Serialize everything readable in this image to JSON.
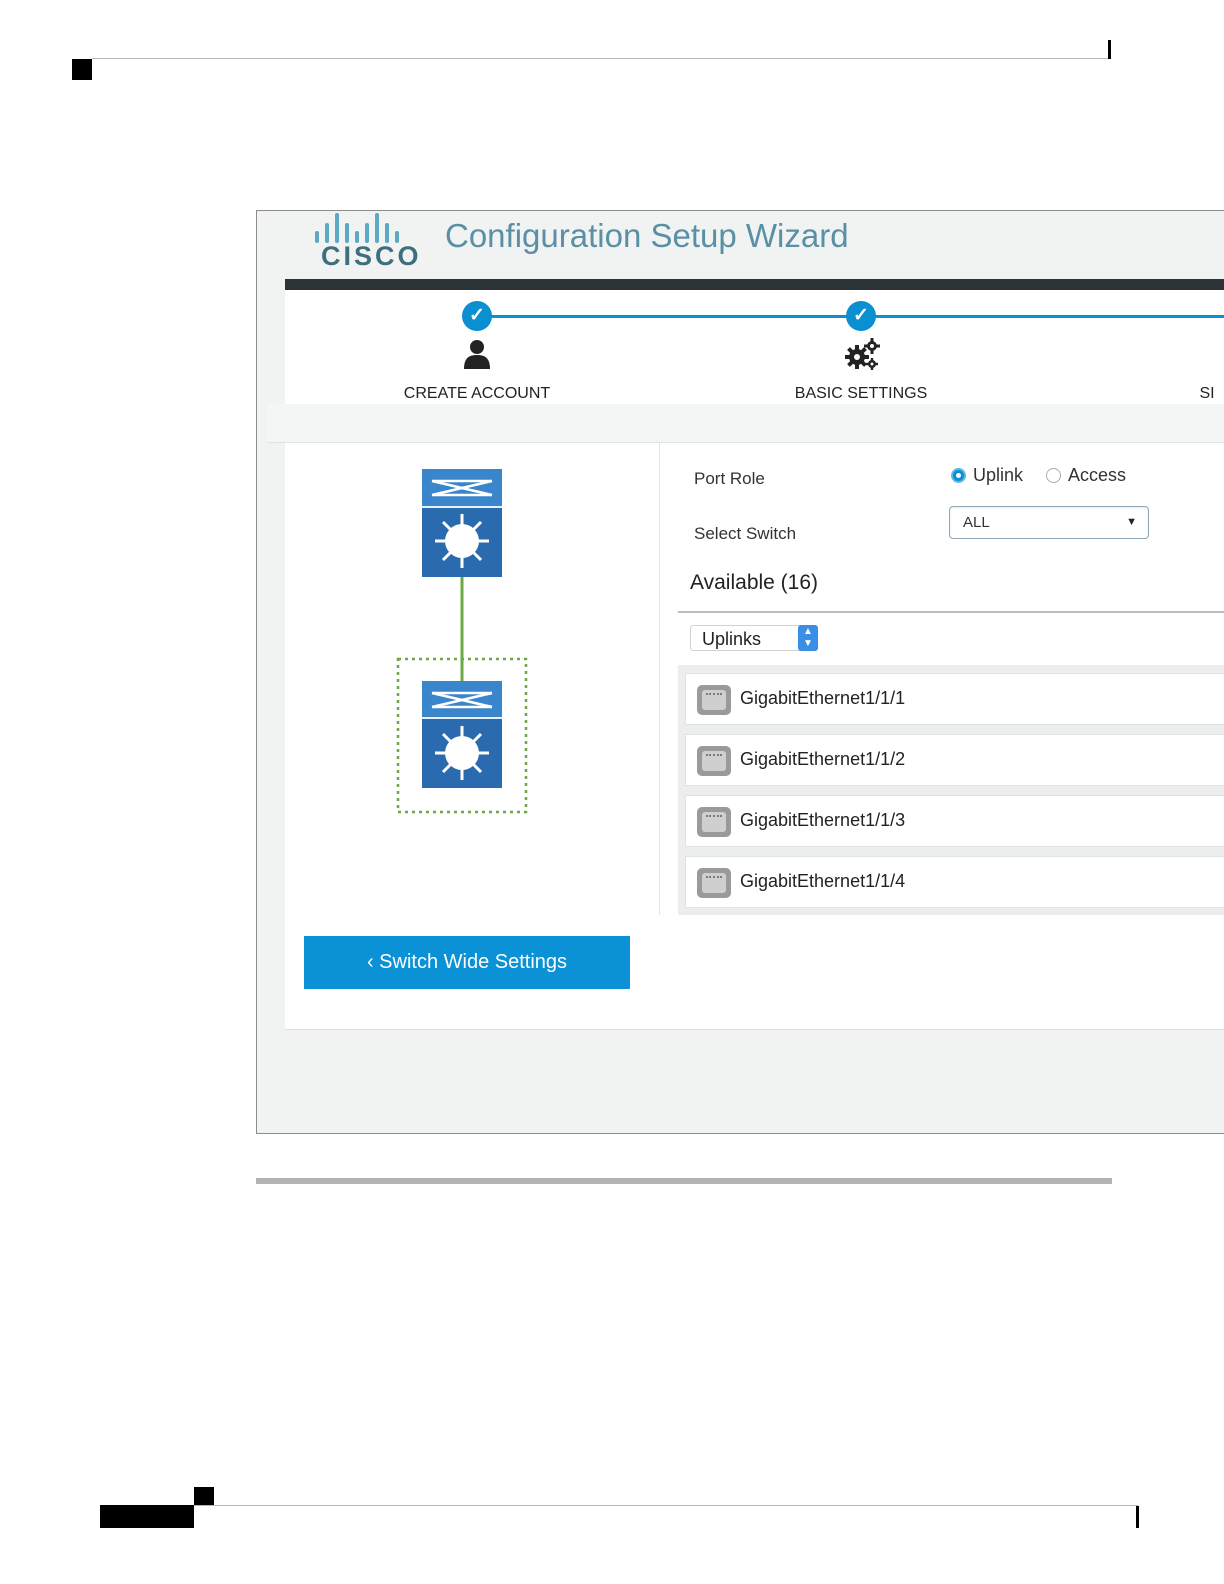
{
  "app": {
    "logo_text": "CISCO",
    "title": "Configuration Setup Wizard"
  },
  "steps": [
    {
      "label": "CREATE ACCOUNT",
      "status_icon": "check-icon",
      "icon": "user-icon"
    },
    {
      "label": "BASIC SETTINGS",
      "status_icon": "check-icon",
      "icon": "gears-icon"
    },
    {
      "label": "SI",
      "status_icon": "",
      "icon": ""
    }
  ],
  "form": {
    "port_role_label": "Port Role",
    "port_role_options": [
      "Uplink",
      "Access"
    ],
    "port_role_selected": "Uplink",
    "select_switch_label": "Select Switch",
    "select_switch_value": "ALL"
  },
  "available": {
    "heading": "Available (16)",
    "filter_value": "Uplinks",
    "ports": [
      "GigabitEthernet1/1/1",
      "GigabitEthernet1/1/2",
      "GigabitEthernet1/1/3",
      "GigabitEthernet1/1/4"
    ]
  },
  "buttons": {
    "back_label": "Switch Wide Settings"
  },
  "colors": {
    "accent": "#0a8fd1",
    "switch_blue": "#2a6bb0",
    "link_green": "#6aaa45"
  }
}
